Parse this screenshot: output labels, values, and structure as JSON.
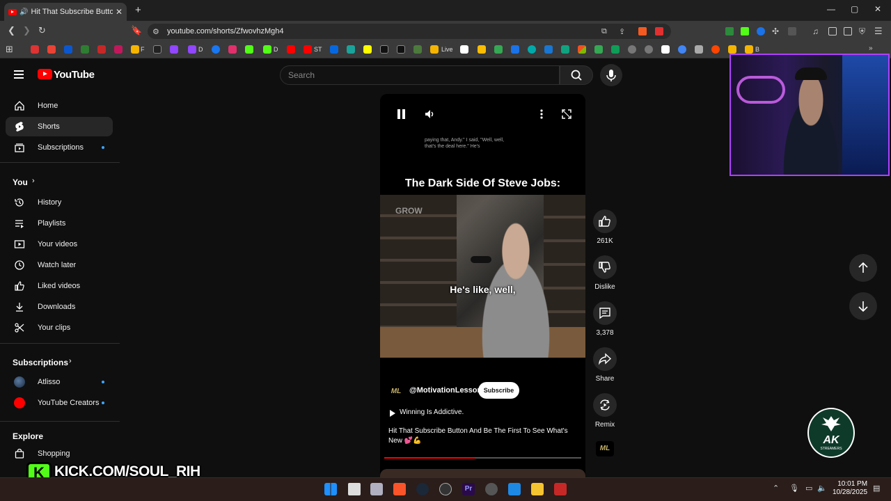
{
  "browser": {
    "tab_title": "Hit That Subscribe Button An",
    "url": "youtube.com/shorts/ZfwovhzMgh4",
    "bookmarks": [
      "F",
      "D",
      "D",
      "ST",
      "Live",
      "B"
    ]
  },
  "youtube": {
    "logo_text": "YouTube",
    "search_placeholder": "Search",
    "sidebar": {
      "main": [
        {
          "label": "Home",
          "icon": "home-icon"
        },
        {
          "label": "Shorts",
          "icon": "shorts-icon",
          "active": true
        },
        {
          "label": "Subscriptions",
          "icon": "subscriptions-icon",
          "dot": true
        }
      ],
      "you_title": "You",
      "you": [
        {
          "label": "History",
          "icon": "history-icon"
        },
        {
          "label": "Playlists",
          "icon": "playlists-icon"
        },
        {
          "label": "Your videos",
          "icon": "your-videos-icon"
        },
        {
          "label": "Watch later",
          "icon": "watch-later-icon"
        },
        {
          "label": "Liked videos",
          "icon": "liked-videos-icon"
        },
        {
          "label": "Downloads",
          "icon": "downloads-icon"
        },
        {
          "label": "Your clips",
          "icon": "clips-icon"
        }
      ],
      "subscriptions_title": "Subscriptions",
      "subscriptions": [
        {
          "label": "Atlisso",
          "dot": true
        },
        {
          "label": "YouTube Creators",
          "dot": true
        }
      ],
      "explore_title": "Explore",
      "explore": [
        {
          "label": "Shopping",
          "icon": "shopping-icon"
        }
      ]
    },
    "short": {
      "overlay_text": "paying that, Andy.\" I said, \"Well, well, that's the deal here.\" He's",
      "video_title": "The Dark Side Of Steve Jobs:",
      "watermark": "GROW",
      "caption": "He's like, well,",
      "channel_avatar": "ML",
      "channel": "@MotivationLesson",
      "subscribe_label": "Subscribe",
      "music": "Winning Is Addictive.",
      "description": "Hit That Subscribe Button And Be The First To See What's New 💕💪",
      "progress": 0.46
    },
    "actions": {
      "likes": "261K",
      "dislike_label": "Dislike",
      "comments": "3,378",
      "share_label": "Share",
      "remix_label": "Remix"
    }
  },
  "overlays": {
    "badge_text": "AK",
    "badge_sub": "STREAMERS",
    "kick_banner": "KICK.COM/SOUL_RIH",
    "kick_logo": "K"
  },
  "taskbar": {
    "time": "10:01 PM",
    "date": "10/28/2025"
  },
  "colors": {
    "accent_red": "#ff0000",
    "kick_green": "#53fc18",
    "webcam_border": "#b040ff"
  }
}
